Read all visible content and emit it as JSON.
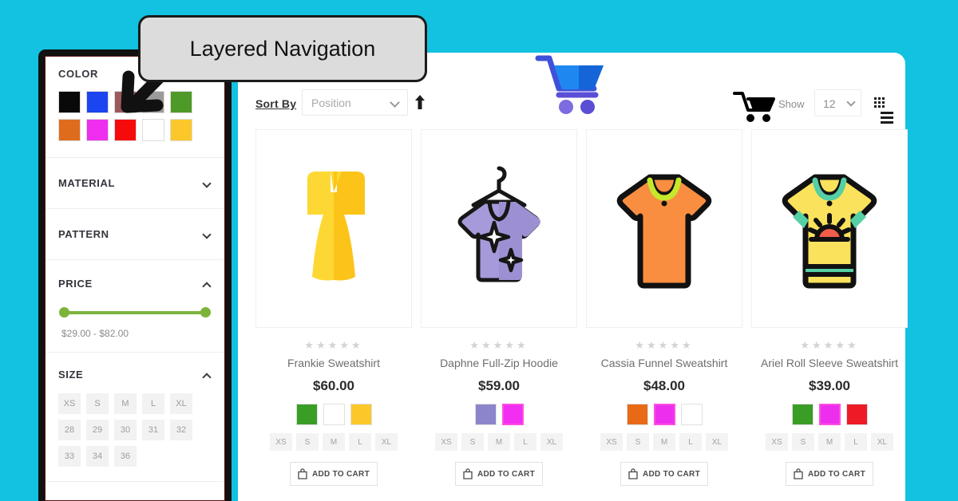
{
  "theme": {
    "background": "#12c2e0",
    "frame": "#111111",
    "accent_green": "#7db33b"
  },
  "callout": {
    "text": "Layered Navigation",
    "arrow_icon": "arrow-down-left-icon"
  },
  "sidebar": {
    "filters": [
      {
        "label": "COLOR",
        "state": "expanded",
        "caret": "chevron-up-icon",
        "swatches": [
          {
            "name": "black",
            "hex": "#090909"
          },
          {
            "name": "blue",
            "hex": "#1a45f0"
          },
          {
            "name": "brown",
            "hex": "#9c5a5a"
          },
          {
            "name": "gray",
            "hex": "#9b9b9b"
          },
          {
            "name": "green",
            "hex": "#4e9a28"
          },
          {
            "name": "orange",
            "hex": "#df6c1c"
          },
          {
            "name": "magenta",
            "hex": "#ef2eef"
          },
          {
            "name": "red",
            "hex": "#f50b0b"
          },
          {
            "name": "white",
            "hex": "#ffffff"
          },
          {
            "name": "yellow",
            "hex": "#fbc72a"
          }
        ]
      },
      {
        "label": "MATERIAL",
        "state": "collapsed",
        "caret": "chevron-down-icon"
      },
      {
        "label": "PATTERN",
        "state": "collapsed",
        "caret": "chevron-down-icon"
      },
      {
        "label": "PRICE",
        "state": "expanded",
        "caret": "chevron-up-icon",
        "range_text": "$29.00 - $82.00",
        "min": "$29.00",
        "max": "$82.00"
      },
      {
        "label": "SIZE",
        "state": "expanded",
        "caret": "chevron-up-icon",
        "sizes": [
          "XS",
          "S",
          "M",
          "L",
          "XL",
          "28",
          "29",
          "30",
          "31",
          "32",
          "33",
          "34",
          "36"
        ]
      }
    ]
  },
  "toolbar": {
    "sort_by_label": "Sort By",
    "sort_value": "Position",
    "sort_direction_icon": "arrow-up-icon",
    "show_label": "Show",
    "show_value": "12",
    "grid_view_icon": "grid-view-icon",
    "list_view_icon": "list-view-icon",
    "cart_icon": "shopping-cart-icon"
  },
  "hero": {
    "cart_icon": "shopping-cart-icon"
  },
  "products": [
    {
      "image_icon": "yellow-dress-icon",
      "rating_stars": "★★★★★",
      "rating_value": 0,
      "name": "Frankie Sweatshirt",
      "price": "$60.00",
      "colors": [
        {
          "name": "green",
          "hex": "#3a9d26",
          "selected": false
        },
        {
          "name": "white",
          "hex": "#ffffff",
          "selected": false
        },
        {
          "name": "yellow",
          "hex": "#fbc72a",
          "selected": false
        }
      ],
      "sizes": [
        "XS",
        "S",
        "M",
        "L",
        "XL"
      ],
      "add_to_cart_label": "ADD TO CART",
      "add_to_cart_icon": "bag-icon"
    },
    {
      "image_icon": "purple-hoodie-hanger-icon",
      "rating_stars": "★★★★★",
      "rating_value": 0,
      "name": "Daphne Full-Zip Hoodie",
      "price": "$59.00",
      "colors": [
        {
          "name": "purple",
          "hex": "#8d85cc",
          "selected": false
        },
        {
          "name": "magenta",
          "hex": "#f22ef2",
          "selected": true
        }
      ],
      "sizes": [
        "XS",
        "S",
        "M",
        "L",
        "XL"
      ],
      "add_to_cart_label": "ADD TO CART",
      "add_to_cart_icon": "bag-icon"
    },
    {
      "image_icon": "orange-tshirt-icon",
      "rating_stars": "★★★★★",
      "rating_value": 0,
      "name": "Cassia Funnel Sweatshirt",
      "price": "$48.00",
      "colors": [
        {
          "name": "orange",
          "hex": "#e96a16",
          "selected": false
        },
        {
          "name": "magenta",
          "hex": "#ee2eee",
          "selected": true
        },
        {
          "name": "white",
          "hex": "#ffffff",
          "selected": false
        }
      ],
      "sizes": [
        "XS",
        "S",
        "M",
        "L",
        "XL"
      ],
      "add_to_cart_label": "ADD TO CART",
      "add_to_cart_icon": "bag-icon"
    },
    {
      "image_icon": "yellow-tshirt-sun-icon",
      "rating_stars": "★★★★★",
      "rating_value": 0,
      "name": "Ariel Roll Sleeve Sweatshirt",
      "price": "$39.00",
      "colors": [
        {
          "name": "green",
          "hex": "#3a9d26",
          "selected": false
        },
        {
          "name": "magenta",
          "hex": "#ee2eee",
          "selected": true
        },
        {
          "name": "red",
          "hex": "#ee1b27",
          "selected": false
        }
      ],
      "sizes": [
        "XS",
        "S",
        "M",
        "L",
        "XL"
      ],
      "add_to_cart_label": "ADD TO CART",
      "add_to_cart_icon": "bag-icon"
    }
  ]
}
